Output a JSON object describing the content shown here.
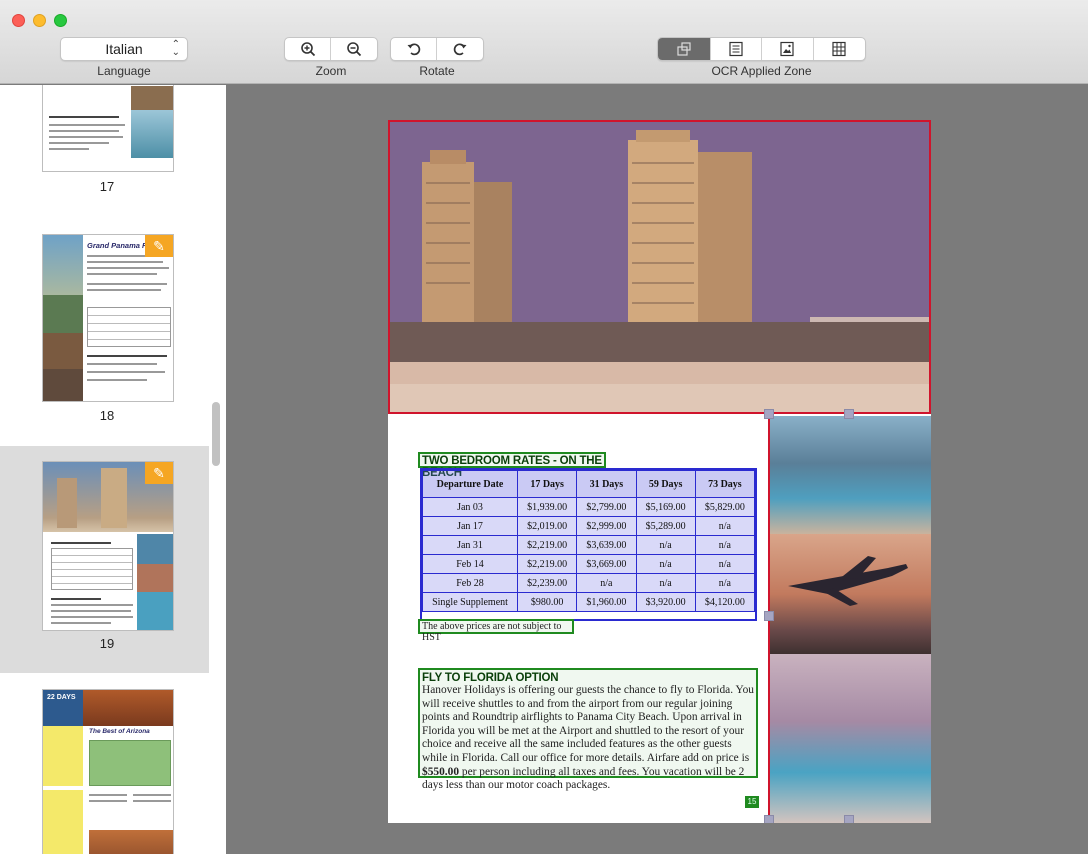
{
  "toolbar": {
    "language_value": "Italian",
    "language_label": "Language",
    "zoom_label": "Zoom",
    "rotate_label": "Rotate",
    "ocr_zone_label": "OCR Applied Zone"
  },
  "sidebar": {
    "pages": [
      {
        "number": "17"
      },
      {
        "number": "18",
        "title": "Grand Panama Resor"
      },
      {
        "number": "19",
        "selected": true
      },
      {
        "number": "",
        "title": "The Best of Arizona",
        "badge": "22 DAYS"
      }
    ]
  },
  "document": {
    "rates_heading": "TWO BEDROOM RATES - ON THE BEACH",
    "table": {
      "headers": [
        "Departure Date",
        "17 Days",
        "31 Days",
        "59 Days",
        "73 Days"
      ],
      "rows": [
        [
          "Jan 03",
          "$1,939.00",
          "$2,799.00",
          "$5,169.00",
          "$5,829.00"
        ],
        [
          "Jan 17",
          "$2,019.00",
          "$2,999.00",
          "$5,289.00",
          "n/a"
        ],
        [
          "Jan 31",
          "$2,219.00",
          "$3,639.00",
          "n/a",
          "n/a"
        ],
        [
          "Feb 14",
          "$2,219.00",
          "$3,669.00",
          "n/a",
          "n/a"
        ],
        [
          "Feb 28",
          "$2,239.00",
          "n/a",
          "n/a",
          "n/a"
        ],
        [
          "Single Supplement",
          "$980.00",
          "$1,960.00",
          "$3,920.00",
          "$4,120.00"
        ]
      ]
    },
    "hst_note": "The above prices are not subject to HST",
    "fly_heading": "FLY TO FLORIDA OPTION",
    "fly_body_1": "Hanover Holidays is offering our guests the chance to fly to Florida. You will receive shuttles to and from the airport from our regular joining points and Roundtrip airflights to Panama City Beach. Upon arrival in Florida you will be met at the Airport and shuttled to the resort of your choice and receive all the same included features as the other guests while in Florida. Call our office for more details. Airfare add on price is ",
    "fly_price": "$550.00",
    "fly_body_2": " per person including all taxes and fees. You vacation will be 2 days less than our motor coach packages.",
    "page_number": "15"
  },
  "colors": {
    "zone_red": "#d0142c",
    "zone_green": "#1f8a1f",
    "zone_blue": "#2a2ad0",
    "edit_badge": "#f5a623"
  }
}
